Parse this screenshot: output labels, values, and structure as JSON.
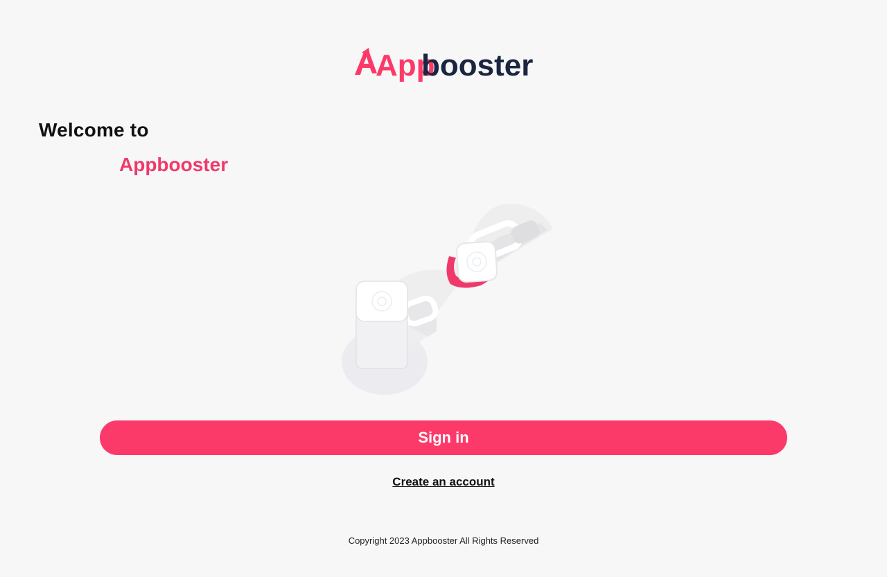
{
  "header": {
    "logo_text_prefix": "App",
    "logo_text_suffix": "booster"
  },
  "welcome": {
    "line1": "Welcome to",
    "line2": "Appbooster"
  },
  "actions": {
    "signin_label": "Sign in",
    "create_account_label": "Create an account"
  },
  "footer": {
    "copyright": "Copyright 2023 Appbooster All Rights Reserved"
  },
  "colors": {
    "brand_pink": "#fc3a69",
    "brand_navy": "#1b2540",
    "background": "#f7f7f7"
  },
  "icons": {
    "hero": "locks-keys-illustration"
  }
}
